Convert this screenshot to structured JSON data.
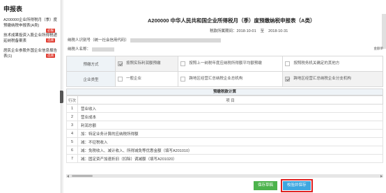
{
  "sidebar": {
    "title": "申报表",
    "items": [
      {
        "label": "A200000企业所得税月（季）度预缴纳税申报表(A类)",
        "badge": "必报"
      },
      {
        "label": "技术成果投资入股企业所得税递延纳税备案表",
        "badge": "选填"
      },
      {
        "label": "居民企业参股外国企业信息报告表(1)",
        "badge": "选填"
      }
    ]
  },
  "form": {
    "title": "A200000    中华人民共和国企业所得税月（季）度预缴纳税申报表（A类）",
    "period_label": "税款所属期间：",
    "period_start": "2018-10-01",
    "period_sep": "至",
    "period_end": "2018-10-31",
    "taxpayer_id_label": "纳税人识别号（统一社会信用代码）",
    "taxpayer_name_label": "纳税人名称：",
    "unit_label": "金额单"
  },
  "prepay": {
    "row_label": "预缴方式",
    "options": [
      {
        "text": "按照实际利润额预缴",
        "checked": true
      },
      {
        "text": "按照上一纳税年度应纳税所得额平均额预缴",
        "checked": false
      },
      {
        "text": "按照税务机关确定的其他方",
        "checked": false
      }
    ]
  },
  "company": {
    "row_label": "企业类型",
    "options": [
      {
        "text": "一般企业",
        "checked": false
      },
      {
        "text": "跨地区经营汇总纳税企业总机构",
        "checked": false
      },
      {
        "text": "跨地区经营汇总纳税企业分支机构",
        "checked": true
      }
    ]
  },
  "calc": {
    "title": "预缴税款计算",
    "col_line": "行次",
    "col_item": "项      目",
    "rows": [
      {
        "num": "1",
        "text": "营业收入"
      },
      {
        "num": "2",
        "text": "营业成本"
      },
      {
        "num": "3",
        "text": "利润总额"
      },
      {
        "num": "4",
        "text": "加：特定业务计算的应纳税所得额"
      },
      {
        "num": "5",
        "text": "减：不征税收入"
      },
      {
        "num": "6",
        "text": "减：免税收入、减计收入、所得减免等优惠金额（填写A201010）"
      },
      {
        "num": "7",
        "text": "减：固定资产加速折旧（扣除）调减额（填写A201020）"
      }
    ]
  },
  "buttons": {
    "save": "保存草稿",
    "verify": "校验并保存"
  }
}
